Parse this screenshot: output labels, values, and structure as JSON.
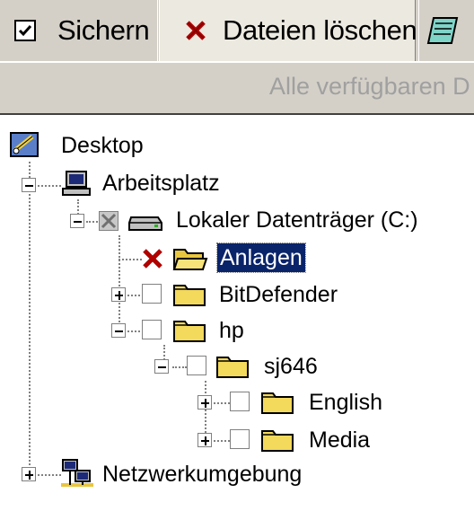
{
  "tabs": [
    {
      "label": "Sichern",
      "icon": "checkbox-checked-icon"
    },
    {
      "label": "Dateien löschen",
      "icon": "red-x-icon"
    },
    {
      "label": "",
      "icon": "notepad-icon"
    }
  ],
  "info_bar": {
    "text": "Alle verfügbaren D"
  },
  "tree": {
    "desktop": "Desktop",
    "arbeitsplatz": "Arbeitsplatz",
    "lokaler": "Lokaler Datenträger (C:)",
    "anlagen": "Anlagen",
    "bitdefender": "BitDefender",
    "hp": "hp",
    "sj646": "sj646",
    "english": "English",
    "media": "Media",
    "netzwerk": "Netzwerkumgebung"
  },
  "colors": {
    "selection": "#0a246a",
    "mark": "#b00000",
    "folder": "#f3d95c"
  }
}
